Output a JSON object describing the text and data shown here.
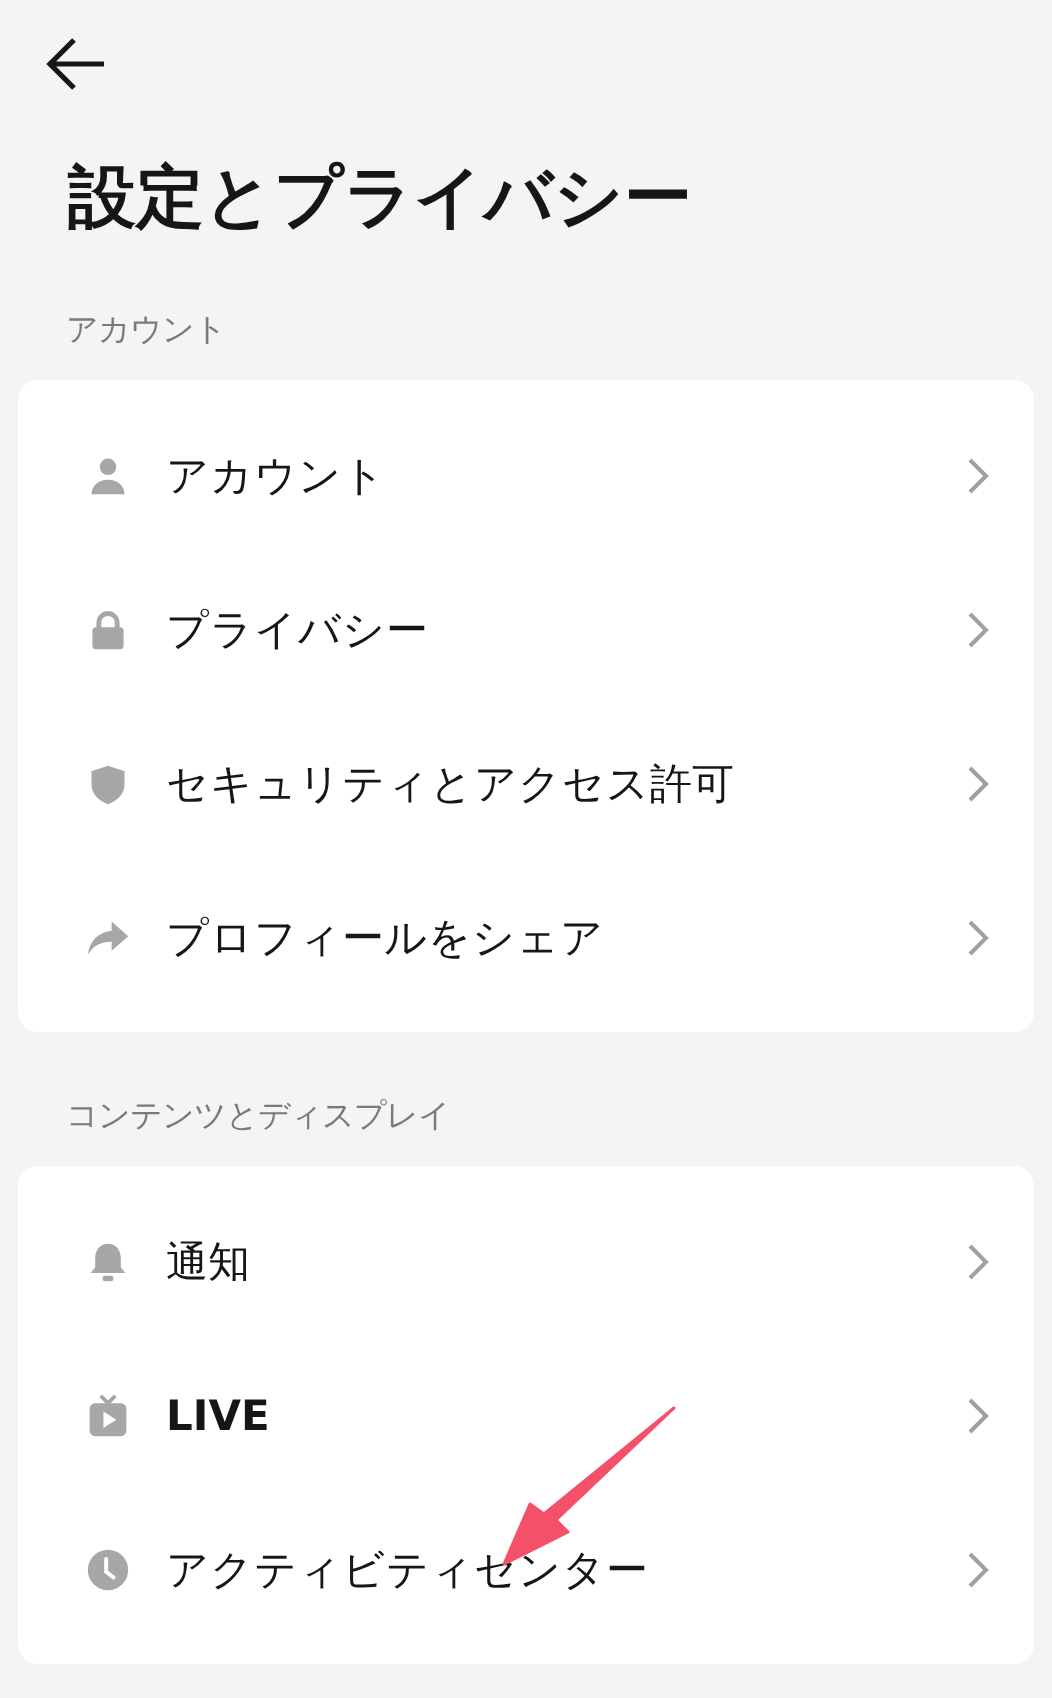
{
  "header": {
    "title": "設定とプライバシー"
  },
  "sections": [
    {
      "label": "アカウント",
      "items": [
        {
          "kind": "person",
          "label": "アカウント",
          "bold": false
        },
        {
          "kind": "lock",
          "label": "プライバシー",
          "bold": false
        },
        {
          "kind": "shield",
          "label": "セキュリティとアクセス許可",
          "bold": false
        },
        {
          "kind": "share",
          "label": "プロフィールをシェア",
          "bold": false
        }
      ]
    },
    {
      "label": "コンテンツとディスプレイ",
      "items": [
        {
          "kind": "bell",
          "label": "通知",
          "bold": false
        },
        {
          "kind": "tv",
          "label": "LIVE",
          "bold": true
        },
        {
          "kind": "clock",
          "label": "アクティビティセンター",
          "bold": false
        }
      ]
    }
  ]
}
